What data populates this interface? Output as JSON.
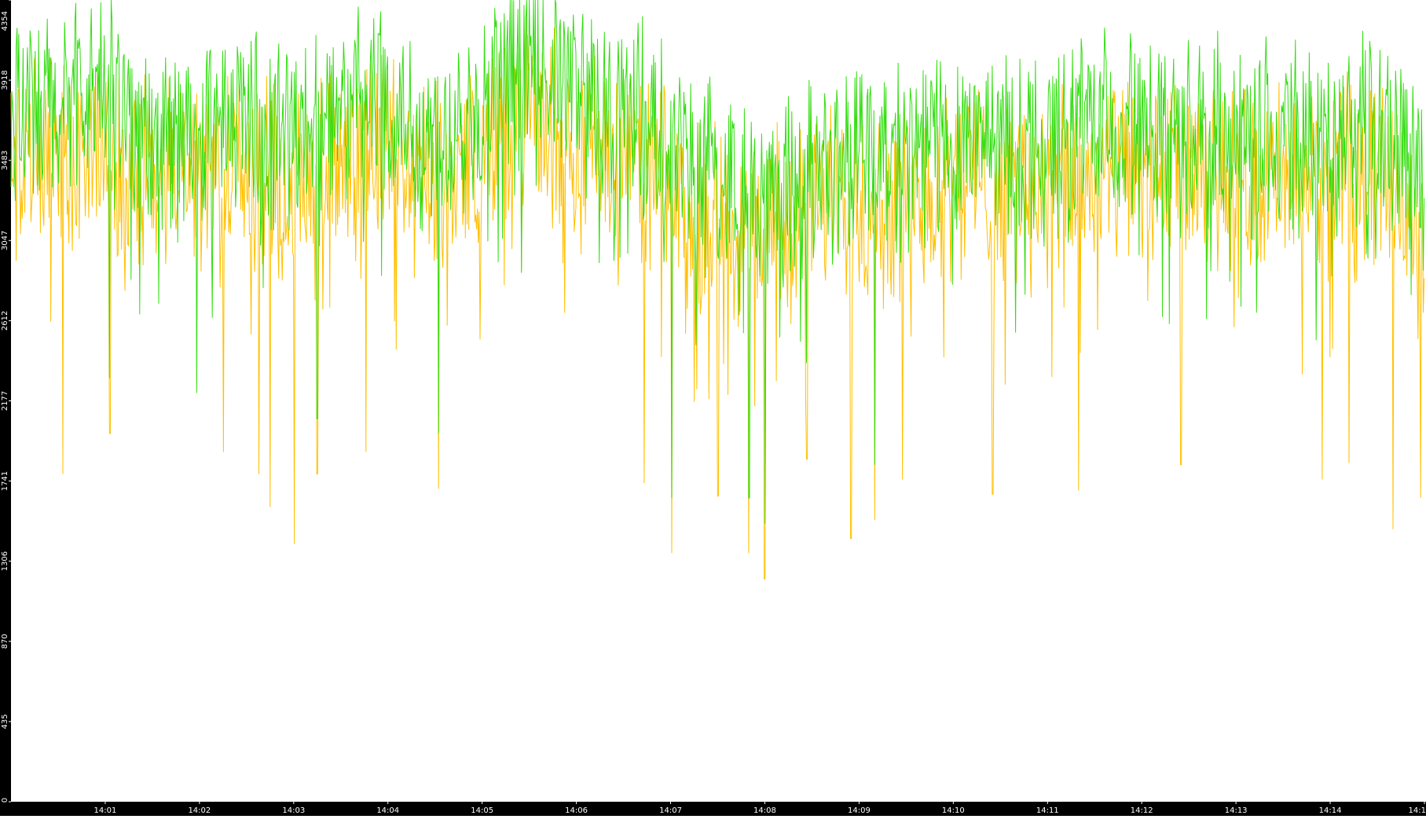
{
  "colors": {
    "background": "#ffffff",
    "axis_panel": "#000000",
    "axis_text": "#ffffff",
    "series_green": "#33dd11",
    "series_orange": "#ffc000"
  },
  "chart_data": {
    "type": "line",
    "title": "",
    "xlabel": "",
    "ylabel": "",
    "ylim": [
      0,
      4354
    ],
    "xlim": [
      "14:00:00",
      "14:15:00"
    ],
    "grid": false,
    "legend": "none",
    "y_ticks": [
      "0",
      "435",
      "870",
      "1306",
      "1741",
      "2177",
      "2612",
      "3047",
      "3483",
      "3918",
      "4354"
    ],
    "x_ticks": [
      {
        "label": "14:01",
        "t": "14:01:00"
      },
      {
        "label": "14:02",
        "t": "14:02:00"
      },
      {
        "label": "14:03",
        "t": "14:03:00"
      },
      {
        "label": "14:04",
        "t": "14:04:00"
      },
      {
        "label": "14:05",
        "t": "14:05:00"
      },
      {
        "label": "14:06",
        "t": "14:06:00"
      },
      {
        "label": "14:07",
        "t": "14:07:00"
      },
      {
        "label": "14:08",
        "t": "14:08:00"
      },
      {
        "label": "14:09",
        "t": "14:09:00"
      },
      {
        "label": "14:10",
        "t": "14:10:00"
      },
      {
        "label": "14:11",
        "t": "14:11:00"
      },
      {
        "label": "14:12",
        "t": "14:12:00"
      },
      {
        "label": "14:13",
        "t": "14:13:00"
      },
      {
        "label": "14:14",
        "t": "14:14:00"
      },
      {
        "label": "14:1",
        "t": "14:15:00"
      }
    ],
    "series": [
      {
        "color": "#33dd11",
        "x": [
          "14:00:00",
          "14:00:30",
          "14:01:00",
          "14:01:30",
          "14:02:00",
          "14:02:30",
          "14:03:00",
          "14:03:30",
          "14:04:00",
          "14:04:30",
          "14:05:00",
          "14:05:30",
          "14:06:00",
          "14:06:30",
          "14:07:00",
          "14:07:30",
          "14:08:00",
          "14:08:30",
          "14:09:00",
          "14:09:30",
          "14:10:00",
          "14:10:30",
          "14:11:00",
          "14:11:30",
          "14:12:00",
          "14:12:30",
          "14:13:00",
          "14:13:30",
          "14:14:00",
          "14:14:30",
          "14:15:00"
        ],
        "y": [
          3700,
          3750,
          3850,
          3600,
          3650,
          3700,
          3600,
          3750,
          3800,
          3600,
          3800,
          4000,
          3850,
          3750,
          3550,
          3350,
          3300,
          3450,
          3550,
          3500,
          3650,
          3600,
          3550,
          3650,
          3650,
          3600,
          3650,
          3600,
          3600,
          3700,
          3400
        ]
      },
      {
        "color": "#ffc000",
        "x": [
          "14:00:00",
          "14:00:30",
          "14:01:00",
          "14:01:30",
          "14:02:00",
          "14:02:30",
          "14:03:00",
          "14:03:30",
          "14:04:00",
          "14:04:30",
          "14:05:00",
          "14:05:30",
          "14:06:00",
          "14:06:30",
          "14:07:00",
          "14:07:30",
          "14:08:00",
          "14:08:30",
          "14:09:00",
          "14:09:30",
          "14:10:00",
          "14:10:30",
          "14:11:00",
          "14:11:30",
          "14:12:00",
          "14:12:30",
          "14:13:00",
          "14:13:30",
          "14:14:00",
          "14:14:30",
          "14:15:00"
        ],
        "y": [
          3450,
          3500,
          3550,
          3350,
          3400,
          3450,
          3350,
          3500,
          3550,
          3350,
          3550,
          3750,
          3600,
          3500,
          3300,
          3150,
          3100,
          3250,
          3300,
          3250,
          3400,
          3350,
          3300,
          3400,
          3400,
          3350,
          3400,
          3350,
          3350,
          3450,
          3150
        ]
      }
    ],
    "annotations": [
      {
        "t": "14:00:33",
        "y": 1780
      },
      {
        "t": "14:01:03",
        "y": 2000
      },
      {
        "t": "14:01:58",
        "y": 1920
      },
      {
        "t": "14:02:15",
        "y": 1900
      },
      {
        "t": "14:02:38",
        "y": 1780
      },
      {
        "t": "14:02:45",
        "y": 1600
      },
      {
        "t": "14:03:00",
        "y": 1400
      },
      {
        "t": "14:03:15",
        "y": 1780
      },
      {
        "t": "14:03:46",
        "y": 1900
      },
      {
        "t": "14:04:32",
        "y": 1700
      },
      {
        "t": "14:05:15",
        "y": 2600
      },
      {
        "t": "14:06:43",
        "y": 1730
      },
      {
        "t": "14:07:01",
        "y": 1350
      },
      {
        "t": "14:07:30",
        "y": 1660
      },
      {
        "t": "14:07:50",
        "y": 1350
      },
      {
        "t": "14:08:00",
        "y": 1210
      },
      {
        "t": "14:08:27",
        "y": 1860
      },
      {
        "t": "14:08:55",
        "y": 1430
      },
      {
        "t": "14:09:10",
        "y": 1530
      },
      {
        "t": "14:09:28",
        "y": 1750
      },
      {
        "t": "14:10:25",
        "y": 1670
      },
      {
        "t": "14:11:20",
        "y": 1690
      },
      {
        "t": "14:12:25",
        "y": 1830
      },
      {
        "t": "14:13:23",
        "y": 1700
      },
      {
        "t": "14:13:55",
        "y": 1750
      },
      {
        "t": "14:14:12",
        "y": 1840
      },
      {
        "t": "14:14:40",
        "y": 1480
      },
      {
        "t": "14:14:58",
        "y": 1650
      }
    ]
  }
}
